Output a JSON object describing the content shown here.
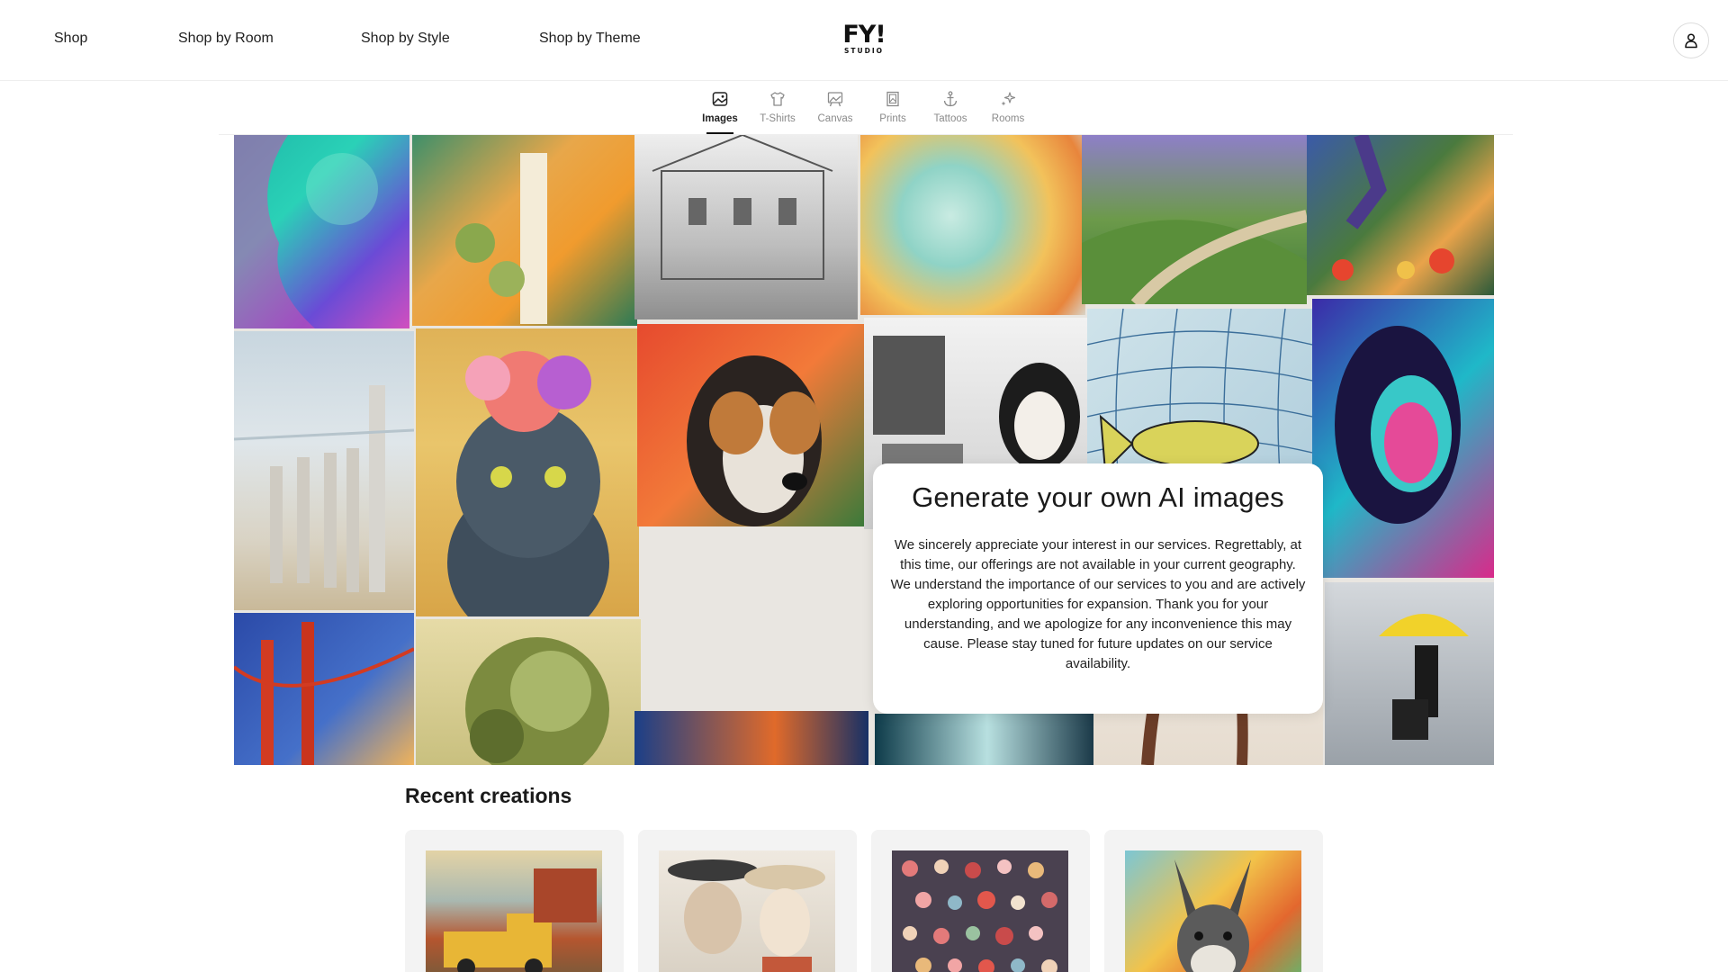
{
  "header": {
    "nav": [
      "Shop",
      "Shop by Room",
      "Shop by Style",
      "Shop by Theme"
    ],
    "logo": {
      "mark": "FY!",
      "sub": "STUDIO"
    }
  },
  "tabs": [
    {
      "label": "Images",
      "icon": "image-icon",
      "active": true
    },
    {
      "label": "T-Shirts",
      "icon": "tshirt-icon",
      "active": false
    },
    {
      "label": "Canvas",
      "icon": "canvas-easel-icon",
      "active": false
    },
    {
      "label": "Prints",
      "icon": "print-frame-icon",
      "active": false
    },
    {
      "label": "Tattoos",
      "icon": "anchor-icon",
      "active": false
    },
    {
      "label": "Rooms",
      "icon": "sparkle-icon",
      "active": false
    }
  ],
  "hero": {
    "title": "Generate your own AI images",
    "message": "We sincerely appreciate your interest in our services. Regrettably, at this time, our offerings are not available in your current geography. We understand the importance of our services to you and are actively exploring opportunities for expansion. Thank you for your understanding, and we apologize for any inconvenience this may cause. Please stay tuned for future updates on our service availability."
  },
  "recent": {
    "title": "Recent creations",
    "items": [
      "vintage-truck-artwork",
      "couple-portrait-artwork",
      "hearts-pattern-artwork",
      "donkey-artwork"
    ]
  },
  "colors": {
    "text": "#1a1a1a",
    "muted": "#8a8a8a",
    "border": "#eeeeee",
    "card_bg": "#f3f3f3"
  }
}
